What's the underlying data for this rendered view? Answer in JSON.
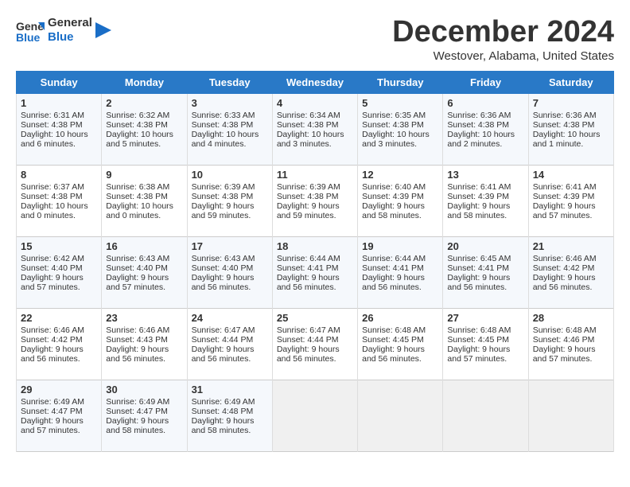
{
  "logo": {
    "line1": "General",
    "line2": "Blue"
  },
  "title": "December 2024",
  "location": "Westover, Alabama, United States",
  "days_of_week": [
    "Sunday",
    "Monday",
    "Tuesday",
    "Wednesday",
    "Thursday",
    "Friday",
    "Saturday"
  ],
  "weeks": [
    [
      {
        "day": 1,
        "sunrise": "6:31 AM",
        "sunset": "4:38 PM",
        "daylight": "10 hours and 6 minutes."
      },
      {
        "day": 2,
        "sunrise": "6:32 AM",
        "sunset": "4:38 PM",
        "daylight": "10 hours and 5 minutes."
      },
      {
        "day": 3,
        "sunrise": "6:33 AM",
        "sunset": "4:38 PM",
        "daylight": "10 hours and 4 minutes."
      },
      {
        "day": 4,
        "sunrise": "6:34 AM",
        "sunset": "4:38 PM",
        "daylight": "10 hours and 3 minutes."
      },
      {
        "day": 5,
        "sunrise": "6:35 AM",
        "sunset": "4:38 PM",
        "daylight": "10 hours and 3 minutes."
      },
      {
        "day": 6,
        "sunrise": "6:36 AM",
        "sunset": "4:38 PM",
        "daylight": "10 hours and 2 minutes."
      },
      {
        "day": 7,
        "sunrise": "6:36 AM",
        "sunset": "4:38 PM",
        "daylight": "10 hours and 1 minute."
      }
    ],
    [
      {
        "day": 8,
        "sunrise": "6:37 AM",
        "sunset": "4:38 PM",
        "daylight": "10 hours and 0 minutes."
      },
      {
        "day": 9,
        "sunrise": "6:38 AM",
        "sunset": "4:38 PM",
        "daylight": "10 hours and 0 minutes."
      },
      {
        "day": 10,
        "sunrise": "6:39 AM",
        "sunset": "4:38 PM",
        "daylight": "9 hours and 59 minutes."
      },
      {
        "day": 11,
        "sunrise": "6:39 AM",
        "sunset": "4:38 PM",
        "daylight": "9 hours and 59 minutes."
      },
      {
        "day": 12,
        "sunrise": "6:40 AM",
        "sunset": "4:39 PM",
        "daylight": "9 hours and 58 minutes."
      },
      {
        "day": 13,
        "sunrise": "6:41 AM",
        "sunset": "4:39 PM",
        "daylight": "9 hours and 58 minutes."
      },
      {
        "day": 14,
        "sunrise": "6:41 AM",
        "sunset": "4:39 PM",
        "daylight": "9 hours and 57 minutes."
      }
    ],
    [
      {
        "day": 15,
        "sunrise": "6:42 AM",
        "sunset": "4:40 PM",
        "daylight": "9 hours and 57 minutes."
      },
      {
        "day": 16,
        "sunrise": "6:43 AM",
        "sunset": "4:40 PM",
        "daylight": "9 hours and 57 minutes."
      },
      {
        "day": 17,
        "sunrise": "6:43 AM",
        "sunset": "4:40 PM",
        "daylight": "9 hours and 56 minutes."
      },
      {
        "day": 18,
        "sunrise": "6:44 AM",
        "sunset": "4:41 PM",
        "daylight": "9 hours and 56 minutes."
      },
      {
        "day": 19,
        "sunrise": "6:44 AM",
        "sunset": "4:41 PM",
        "daylight": "9 hours and 56 minutes."
      },
      {
        "day": 20,
        "sunrise": "6:45 AM",
        "sunset": "4:41 PM",
        "daylight": "9 hours and 56 minutes."
      },
      {
        "day": 21,
        "sunrise": "6:46 AM",
        "sunset": "4:42 PM",
        "daylight": "9 hours and 56 minutes."
      }
    ],
    [
      {
        "day": 22,
        "sunrise": "6:46 AM",
        "sunset": "4:42 PM",
        "daylight": "9 hours and 56 minutes."
      },
      {
        "day": 23,
        "sunrise": "6:46 AM",
        "sunset": "4:43 PM",
        "daylight": "9 hours and 56 minutes."
      },
      {
        "day": 24,
        "sunrise": "6:47 AM",
        "sunset": "4:44 PM",
        "daylight": "9 hours and 56 minutes."
      },
      {
        "day": 25,
        "sunrise": "6:47 AM",
        "sunset": "4:44 PM",
        "daylight": "9 hours and 56 minutes."
      },
      {
        "day": 26,
        "sunrise": "6:48 AM",
        "sunset": "4:45 PM",
        "daylight": "9 hours and 56 minutes."
      },
      {
        "day": 27,
        "sunrise": "6:48 AM",
        "sunset": "4:45 PM",
        "daylight": "9 hours and 57 minutes."
      },
      {
        "day": 28,
        "sunrise": "6:48 AM",
        "sunset": "4:46 PM",
        "daylight": "9 hours and 57 minutes."
      }
    ],
    [
      {
        "day": 29,
        "sunrise": "6:49 AM",
        "sunset": "4:47 PM",
        "daylight": "9 hours and 57 minutes."
      },
      {
        "day": 30,
        "sunrise": "6:49 AM",
        "sunset": "4:47 PM",
        "daylight": "9 hours and 58 minutes."
      },
      {
        "day": 31,
        "sunrise": "6:49 AM",
        "sunset": "4:48 PM",
        "daylight": "9 hours and 58 minutes."
      },
      null,
      null,
      null,
      null
    ]
  ]
}
